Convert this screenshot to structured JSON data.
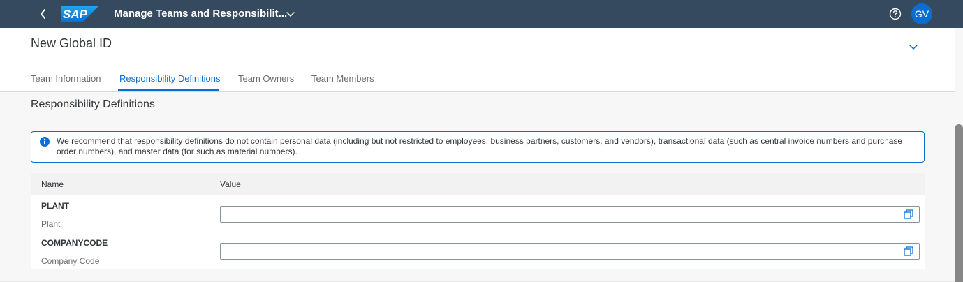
{
  "shellbar": {
    "brand_logo_text": "SAP",
    "app_title": "Manage Teams and Responsibilit...",
    "user_initials": "GV",
    "colors": {
      "background": "#354a5f",
      "avatar": "#0a6ed1"
    }
  },
  "header": {
    "title": "New Global ID",
    "tabs": [
      {
        "label": "Team Information",
        "active": false
      },
      {
        "label": "Responsibility Definitions",
        "active": true
      },
      {
        "label": "Team Owners",
        "active": false
      },
      {
        "label": "Team Members",
        "active": false
      }
    ]
  },
  "section": {
    "title": "Responsibility Definitions",
    "info_message": "We recommend that responsibility definitions do not contain personal data (including but not restricted to employees, business partners, customers, and vendors), transactional data (such as central invoice numbers and purchase order numbers), and master data (for such as material numbers)."
  },
  "table": {
    "columns": [
      "Name",
      "Value"
    ],
    "rows": [
      {
        "key": "PLANT",
        "description": "Plant",
        "value": ""
      },
      {
        "key": "COMPANYCODE",
        "description": "Company Code",
        "value": ""
      }
    ]
  },
  "icons": {
    "back": "chevron-left-icon",
    "title_dropdown": "chevron-down-icon",
    "help": "question-circle-icon",
    "expand_header": "chevron-down-icon",
    "info": "information-icon",
    "value_help": "value-help-icon"
  },
  "colors": {
    "accent": "#0a6ed1",
    "text": "#32363a"
  }
}
